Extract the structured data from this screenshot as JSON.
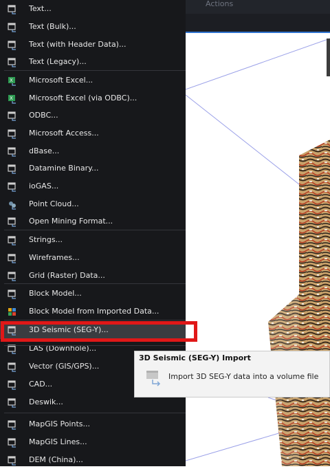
{
  "header": {
    "actions_label": "Actions"
  },
  "menu": {
    "items": [
      {
        "label": "Text...",
        "icon": "import-text-icon"
      },
      {
        "label": "Text (Bulk)...",
        "icon": "import-text-icon"
      },
      {
        "label": "Text (with Header Data)...",
        "icon": "import-text-icon"
      },
      {
        "label": "Text (Legacy)...",
        "icon": "import-text-icon"
      },
      {
        "label": "Microsoft Excel...",
        "icon": "excel-icon"
      },
      {
        "label": "Microsoft Excel (via ODBC)...",
        "icon": "excel-icon"
      },
      {
        "label": "ODBC...",
        "icon": "import-text-icon"
      },
      {
        "label": "Microsoft Access...",
        "icon": "import-text-icon"
      },
      {
        "label": "dBase...",
        "icon": "import-text-icon"
      },
      {
        "label": "Datamine Binary...",
        "icon": "import-text-icon"
      },
      {
        "label": "ioGAS...",
        "icon": "import-text-icon"
      },
      {
        "label": "Point Cloud...",
        "icon": "point-cloud-icon"
      },
      {
        "label": "Open Mining Format...",
        "icon": "import-text-icon"
      },
      {
        "label": "Strings...",
        "icon": "import-text-icon"
      },
      {
        "label": "Wireframes...",
        "icon": "import-text-icon"
      },
      {
        "label": "Grid (Raster) Data...",
        "icon": "import-text-icon"
      },
      {
        "label": "Block Model...",
        "icon": "import-text-icon"
      },
      {
        "label": "Block Model from Imported Data...",
        "icon": "block-model-icon"
      },
      {
        "label": "3D Seismic (SEG-Y)...",
        "icon": "import-text-icon"
      },
      {
        "label": "LAS (Downhole)...",
        "icon": "import-text-icon"
      },
      {
        "label": "Vector (GIS/GPS)...",
        "icon": "import-text-icon"
      },
      {
        "label": "CAD...",
        "icon": "import-text-icon"
      },
      {
        "label": "Deswik...",
        "icon": "import-text-icon"
      },
      {
        "label": "MapGIS Points...",
        "icon": "import-text-icon"
      },
      {
        "label": "MapGIS Lines...",
        "icon": "import-text-icon"
      },
      {
        "label": "DEM (China)...",
        "icon": "import-text-icon"
      }
    ]
  },
  "tooltip": {
    "title": "3D Seismic (SEG-Y) Import",
    "description": "Import 3D SEG-Y data into a volume file",
    "icon": "import-file-icon"
  },
  "colors": {
    "menu_bg": "#17181b",
    "highlight": "#3a3c40",
    "callout_red": "#e01818",
    "accent_blue": "#2f74d0"
  }
}
